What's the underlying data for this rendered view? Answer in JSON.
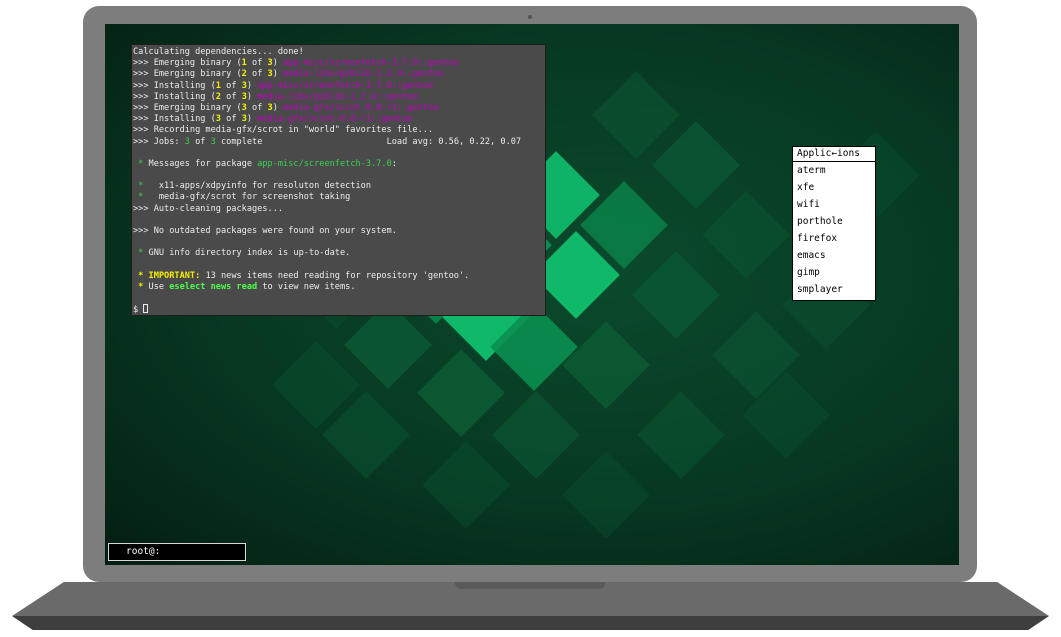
{
  "terminal": {
    "lines": [
      [
        {
          "t": "Calculating dependencies... done!"
        }
      ],
      [
        {
          "t": ">>> Emerging binary ("
        },
        {
          "t": "1",
          "c": "c-yel"
        },
        {
          "t": " of "
        },
        {
          "t": "3",
          "c": "c-yel"
        },
        {
          "t": ") "
        },
        {
          "t": "app-misc/screenfetch-3.7.0::gentoo",
          "c": "c-mag"
        }
      ],
      [
        {
          "t": ">>> Emerging binary ("
        },
        {
          "t": "2",
          "c": "c-yel"
        },
        {
          "t": " of "
        },
        {
          "t": "3",
          "c": "c-yel"
        },
        {
          "t": ") "
        },
        {
          "t": "media-libs/giblib-1.2.4::gentoo",
          "c": "c-mag"
        }
      ],
      [
        {
          "t": ">>> Installing ("
        },
        {
          "t": "1",
          "c": "c-yel"
        },
        {
          "t": " of "
        },
        {
          "t": "3",
          "c": "c-yel"
        },
        {
          "t": ") "
        },
        {
          "t": "app-misc/screenfetch-3.7.0::gentoo",
          "c": "c-mag"
        }
      ],
      [
        {
          "t": ">>> Installing ("
        },
        {
          "t": "2",
          "c": "c-yel"
        },
        {
          "t": " of "
        },
        {
          "t": "3",
          "c": "c-yel"
        },
        {
          "t": ") "
        },
        {
          "t": "media-libs/giblib-1.2.4::gentoo",
          "c": "c-mag"
        }
      ],
      [
        {
          "t": ">>> Emerging binary ("
        },
        {
          "t": "3",
          "c": "c-yel"
        },
        {
          "t": " of "
        },
        {
          "t": "3",
          "c": "c-yel"
        },
        {
          "t": ") "
        },
        {
          "t": "media-gfx/scrot-0.8-r1::gentoo",
          "c": "c-mag"
        }
      ],
      [
        {
          "t": ">>> Installing ("
        },
        {
          "t": "3",
          "c": "c-yel"
        },
        {
          "t": " of "
        },
        {
          "t": "3",
          "c": "c-yel"
        },
        {
          "t": ") "
        },
        {
          "t": "media-gfx/scrot-0.8-r1::gentoo",
          "c": "c-mag"
        }
      ],
      [
        {
          "t": ">>> Recording media-gfx/scrot in \"world\" favorites file..."
        }
      ],
      [
        {
          "t": ">>> Jobs: "
        },
        {
          "t": "3",
          "c": "c-grn"
        },
        {
          "t": " of "
        },
        {
          "t": "3",
          "c": "c-grn"
        },
        {
          "t": " complete                        Load avg: 0.56, 0.22, 0.07"
        }
      ],
      [
        {
          "t": ""
        }
      ],
      [
        {
          "t": " * ",
          "c": "c-grn"
        },
        {
          "t": "Messages for package "
        },
        {
          "t": "app-misc/screenfetch-3.7.0",
          "c": "c-grn"
        },
        {
          "t": ":"
        }
      ],
      [
        {
          "t": ""
        }
      ],
      [
        {
          "t": " * ",
          "c": "c-grn"
        },
        {
          "t": "  x11-apps/xdpyinfo for resoluton detection"
        }
      ],
      [
        {
          "t": " * ",
          "c": "c-grn"
        },
        {
          "t": "  media-gfx/scrot for screenshot taking"
        }
      ],
      [
        {
          "t": ">>> Auto-cleaning packages..."
        }
      ],
      [
        {
          "t": ""
        }
      ],
      [
        {
          "t": ">>> No outdated packages were found on your system."
        }
      ],
      [
        {
          "t": ""
        }
      ],
      [
        {
          "t": " * ",
          "c": "c-grn"
        },
        {
          "t": "GNU info directory index is up-to-date."
        }
      ],
      [
        {
          "t": ""
        }
      ],
      [
        {
          "t": " * ",
          "c": "c-yel"
        },
        {
          "t": "IMPORTANT:",
          "c": "c-yel"
        },
        {
          "t": " 13 news items need reading for repository 'gentoo'."
        }
      ],
      [
        {
          "t": " * ",
          "c": "c-yel"
        },
        {
          "t": "Use "
        },
        {
          "t": "eselect news read",
          "c": "c-grn-b"
        },
        {
          "t": " to view new items."
        }
      ],
      [
        {
          "t": ""
        }
      ],
      [
        {
          "t": "$ "
        }
      ]
    ]
  },
  "menu": {
    "title": "Applic←ions",
    "items": [
      "aterm",
      "xfe",
      "wifi",
      "porthole",
      "firefox",
      "emacs",
      "gimp",
      "smplayer"
    ]
  },
  "prompt": {
    "label": "root@:"
  },
  "colors": {
    "wallpaper": "#073822",
    "tile_bright": "#10b96a",
    "tile_mid": "#0a8f50",
    "tile_dark": "#0b5a34",
    "terminal_bg": "#4a4a4a",
    "package_name": "#c000c0",
    "highlight_yellow": "#f5f000",
    "bullet_green": "#39d353"
  }
}
